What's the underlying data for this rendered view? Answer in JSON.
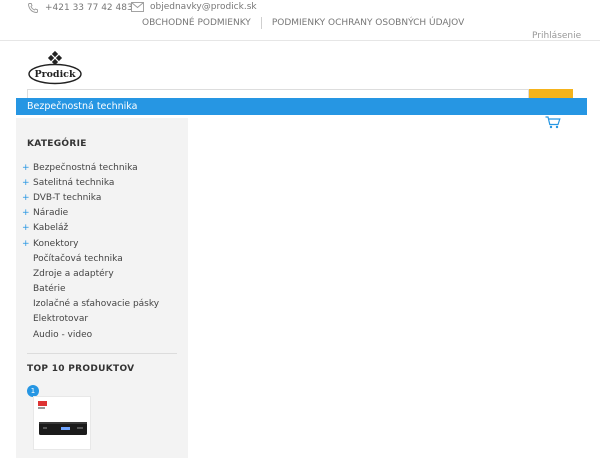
{
  "header": {
    "phone": "+421 33 77 42 483",
    "email": "objednavky@prodick.sk",
    "links": [
      "OBCHODNÉ PODMIENKY",
      "PODMIENKY OCHRANY OSOBNÝCH ÚDAJOV"
    ],
    "login": "Prihlásenie"
  },
  "logo": {
    "text": "Prodick"
  },
  "category_bar": {
    "label": "Bezpečnostná technika"
  },
  "sidebar": {
    "categories_title": "KATEGÓRIE",
    "categories": [
      {
        "label": "Bezpečnostná technika",
        "expandable": true
      },
      {
        "label": "Satelitná technika",
        "expandable": true
      },
      {
        "label": "DVB-T technika",
        "expandable": true
      },
      {
        "label": "Náradie",
        "expandable": true
      },
      {
        "label": "Kabeláž",
        "expandable": true
      },
      {
        "label": "Konektory",
        "expandable": true
      },
      {
        "label": "Počítačová technika",
        "expandable": false
      },
      {
        "label": "Zdroje a adaptéry",
        "expandable": false
      },
      {
        "label": "Batérie",
        "expandable": false
      },
      {
        "label": "Izolačné a sťahovacie pásky",
        "expandable": false
      },
      {
        "label": "Elektrotovar",
        "expandable": false
      },
      {
        "label": "Audio - video",
        "expandable": false
      }
    ],
    "top_title": "TOP 10 PRODUKTOV",
    "top_products": [
      {
        "rank": "1"
      }
    ]
  },
  "colors": {
    "accent": "#2696e3",
    "search_button": "#f5b31b",
    "sidebar_bg": "#f3f3f3"
  },
  "icons": [
    "phone-icon",
    "mail-icon",
    "cart-icon",
    "plus-icon"
  ]
}
